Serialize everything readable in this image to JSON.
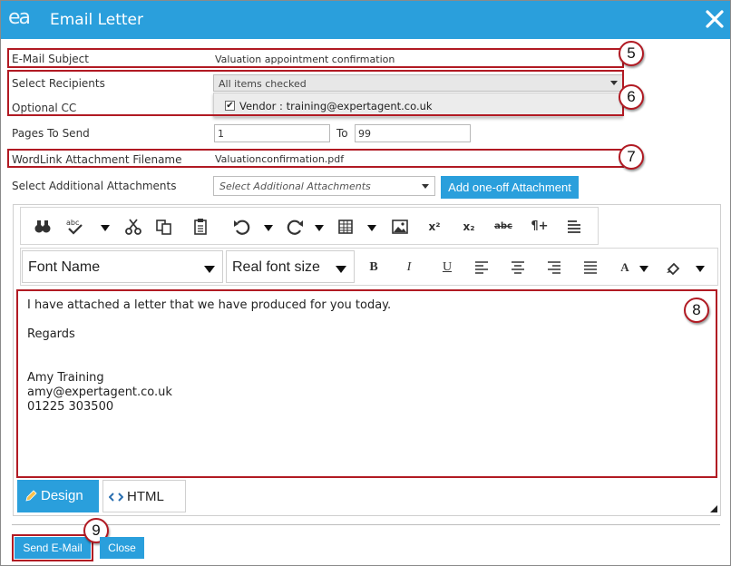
{
  "window": {
    "logo_text": "ea",
    "title": "Email Letter",
    "close_icon": "close-icon"
  },
  "form": {
    "subject_label": "E-Mail Subject",
    "subject_value": "Valuation appointment confirmation",
    "recipients_label": "Select Recipients",
    "recipients_value": "All items checked",
    "recipient_option": "Vendor : training@expertagent.co.uk",
    "recipient_option_checked": true,
    "cc_label": "Optional CC",
    "pages_label": "Pages To Send",
    "pages_from": "1",
    "pages_to_label": "To",
    "pages_to": "99",
    "wordlink_label": "WordLink Attachment Filename",
    "wordlink_value": "Valuationconfirmation.pdf",
    "attachments_label": "Select Additional Attachments",
    "attachments_placeholder": "Select Additional Attachments",
    "add_attachment_button": "Add one-off Attachment"
  },
  "editor": {
    "toolbar_row1": [
      "find-icon",
      "spellcheck-icon",
      "cut-icon",
      "copy-icon",
      "paste-icon",
      "undo-icon",
      "redo-icon",
      "table-icon",
      "image-icon",
      "superscript-icon",
      "subscript-icon",
      "strikethrough-icon",
      "paragraph-insert-icon",
      "align-icon"
    ],
    "font_name": "Font Name",
    "font_size": "Real font size",
    "toolbar_row2": [
      "bold-icon",
      "italic-icon",
      "underline-icon",
      "align-left-icon",
      "align-center-icon",
      "align-right-icon",
      "justify-icon",
      "font-color-icon",
      "highlight-icon"
    ],
    "bold_glyph": "B",
    "italic_glyph": "I",
    "underline_glyph": "U",
    "font_color_glyph": "A",
    "superscript_glyph": "x²",
    "subscript_glyph": "x₂",
    "strike_glyph": "abc",
    "paragraph_glyph": "¶+",
    "body_lines": [
      "I have attached a letter that we have produced for you today.",
      "",
      "Regards",
      "",
      "",
      "Amy Training",
      "amy@expertagent.co.uk",
      "01225 303500"
    ],
    "tab_design": "Design",
    "tab_html": "HTML"
  },
  "footer": {
    "send_button": "Send E-Mail",
    "close_button": "Close"
  },
  "annotations": {
    "badge_5": "5",
    "badge_6": "6",
    "badge_7": "7",
    "badge_8": "8",
    "badge_9": "9"
  },
  "colors": {
    "accent": "#2a9fdc",
    "annotation_red": "#b11a23"
  }
}
